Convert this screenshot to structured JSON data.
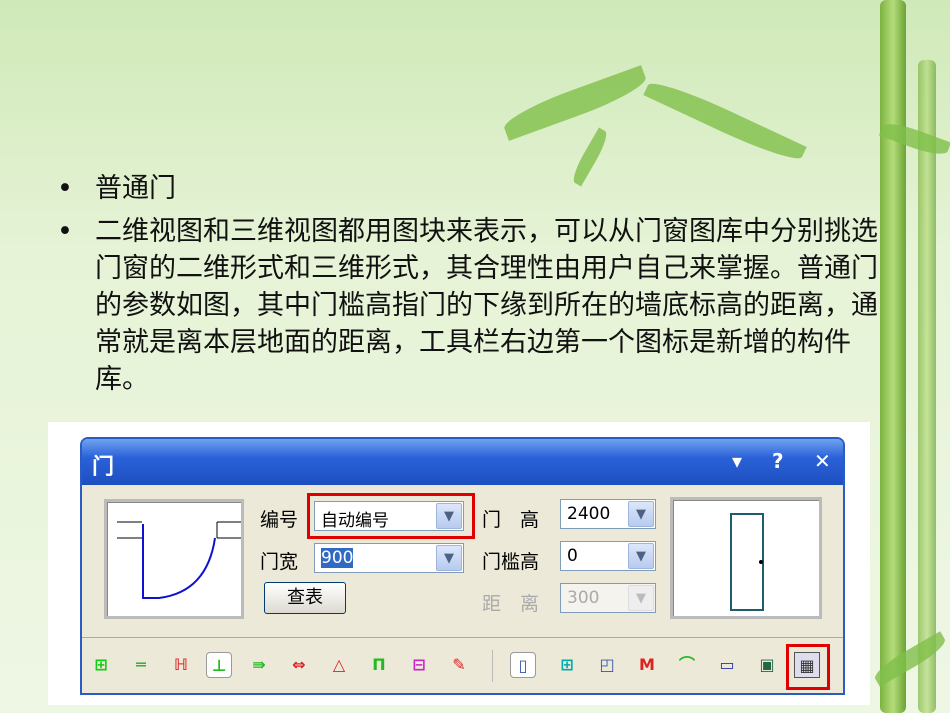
{
  "slide": {
    "bullets": [
      "普通门",
      "二维视图和三维视图都用图块来表示，可以从门窗图库中分别挑选门窗的二维形式和三维形式，其合理性由用户自己来掌握。普通门的参数如图，其中门槛高指门的下缘到所在的墙底标高的距离，通常就是离本层地面的距离，工具栏右边第一个图标是新增的构件库。"
    ]
  },
  "dialog": {
    "title": "门",
    "pin": "▾",
    "help": "?",
    "close": "✕",
    "fields": {
      "number_label": "编号",
      "number_value": "自动编号",
      "width_label": "门宽",
      "width_value": "900",
      "table_button": "查表",
      "height_label": "门　高",
      "height_value": "2400",
      "sill_label": "门槛高",
      "sill_value": "0",
      "distance_label": "距　离",
      "distance_value": "300"
    },
    "toolbar": [
      "insert-center-icon",
      "insert-wall-icon",
      "insert-axis-icon",
      "insert-endpoint-icon",
      "insert-offset-icon",
      "insert-distance-icon",
      "insert-angle-icon",
      "fill-wall-icon",
      "window-combo-icon",
      "replace-icon",
      "normal-door-icon",
      "window-icon",
      "door-window-icon",
      "corner-window-icon",
      "arc-window-icon",
      "opening-icon",
      "niche-icon",
      "component-library-icon"
    ]
  },
  "colors": {
    "accent": "#e00000",
    "title": "#2b62d8"
  }
}
